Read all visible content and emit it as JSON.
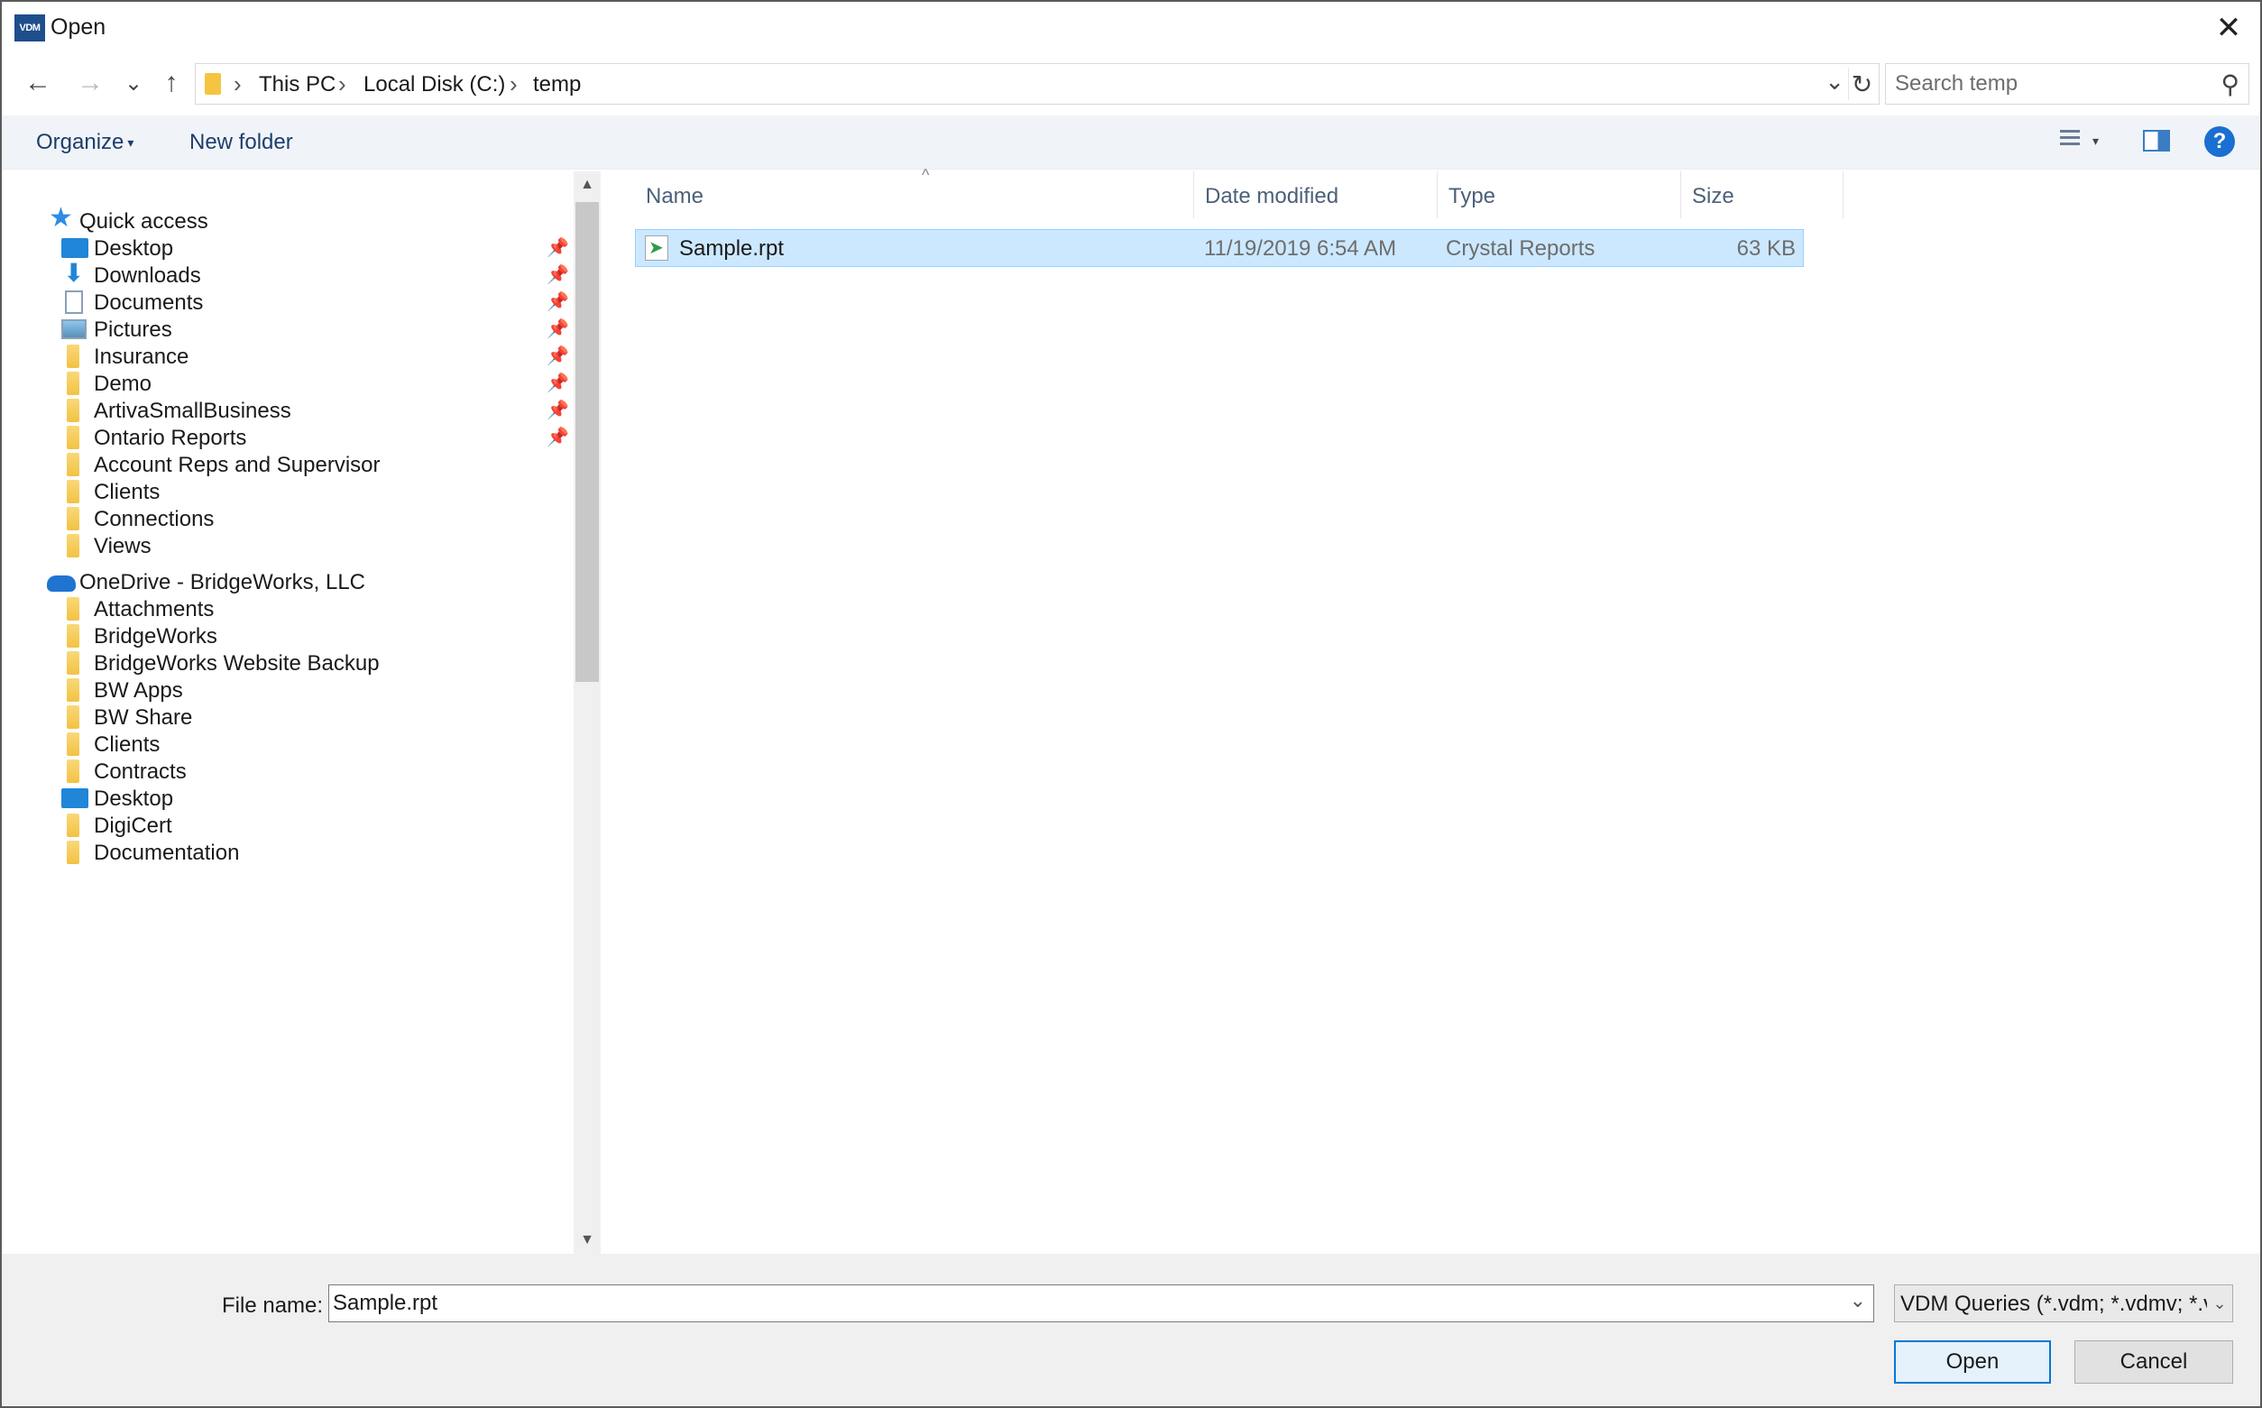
{
  "window": {
    "app_icon_text": "VDM",
    "title": "Open",
    "close_glyph": "✕"
  },
  "navigation": {
    "back_glyph": "←",
    "forward_glyph": "→",
    "recent_glyph": "⌄",
    "up_glyph": "↑",
    "breadcrumbs": [
      "This PC",
      "Local Disk (C:)",
      "temp"
    ],
    "separator": "›",
    "dropdown_glyph": "⌄",
    "refresh_glyph": "↻"
  },
  "search": {
    "placeholder": "Search temp",
    "icon_glyph": "⚲"
  },
  "toolbar": {
    "organize_label": "Organize",
    "organize_caret": "▾",
    "new_folder_label": "New folder",
    "view_caret": "▾",
    "help_label": "?"
  },
  "sidebar": {
    "quick_access_label": "Quick access",
    "quick_access_items": [
      {
        "label": "Desktop",
        "icon": "desktop-icon",
        "pinned": true
      },
      {
        "label": "Downloads",
        "icon": "downloads-icon",
        "pinned": true
      },
      {
        "label": "Documents",
        "icon": "documents-icon",
        "pinned": true
      },
      {
        "label": "Pictures",
        "icon": "pictures-icon",
        "pinned": true
      },
      {
        "label": "Insurance",
        "icon": "folder-icon",
        "pinned": true
      },
      {
        "label": "Demo",
        "icon": "folder-icon",
        "pinned": true
      },
      {
        "label": "ArtivaSmallBusiness",
        "icon": "folder-icon",
        "pinned": true
      },
      {
        "label": "Ontario Reports",
        "icon": "folder-icon",
        "pinned": true
      },
      {
        "label": "Account Reps and Supervisor",
        "icon": "folder-icon",
        "pinned": false
      },
      {
        "label": "Clients",
        "icon": "folder-icon",
        "pinned": false
      },
      {
        "label": "Connections",
        "icon": "folder-icon",
        "pinned": false
      },
      {
        "label": "Views",
        "icon": "folder-icon",
        "pinned": false
      }
    ],
    "onedrive_label": "OneDrive - BridgeWorks, LLC",
    "onedrive_items": [
      {
        "label": "Attachments",
        "icon": "folder-icon"
      },
      {
        "label": "BridgeWorks",
        "icon": "folder-icon"
      },
      {
        "label": "BridgeWorks Website Backup",
        "icon": "folder-icon"
      },
      {
        "label": "BW Apps",
        "icon": "folder-icon"
      },
      {
        "label": "BW Share",
        "icon": "folder-icon"
      },
      {
        "label": "Clients",
        "icon": "folder-icon"
      },
      {
        "label": "Contracts",
        "icon": "folder-icon"
      },
      {
        "label": "Desktop",
        "icon": "desktop-icon"
      },
      {
        "label": "DigiCert",
        "icon": "folder-icon"
      },
      {
        "label": "Documentation",
        "icon": "folder-icon"
      }
    ],
    "pin_glyph": "📌",
    "scroll_up_glyph": "▲",
    "scroll_down_glyph": "▼"
  },
  "file_list": {
    "columns": [
      "Name",
      "Date modified",
      "Type",
      "Size"
    ],
    "sort_glyph": "^",
    "rows": [
      {
        "name": "Sample.rpt",
        "date_modified": "11/19/2019 6:54 AM",
        "type": "Crystal Reports",
        "size": "63 KB",
        "selected": true
      }
    ]
  },
  "footer": {
    "file_name_label": "File name:",
    "file_name_value": "Sample.rpt",
    "file_name_dropdown": "⌄",
    "filter_value": "VDM Queries (*.vdm; *.vdmv; *.vdmq)",
    "filter_caret": "⌄",
    "open_label": "Open",
    "cancel_label": "Cancel"
  },
  "colors": {
    "selection_bg": "#cce8ff",
    "selection_border": "#99d1ff",
    "accent": "#0078d7",
    "toolbar_bg": "#f0f4f9",
    "folder": "#f3c242"
  }
}
